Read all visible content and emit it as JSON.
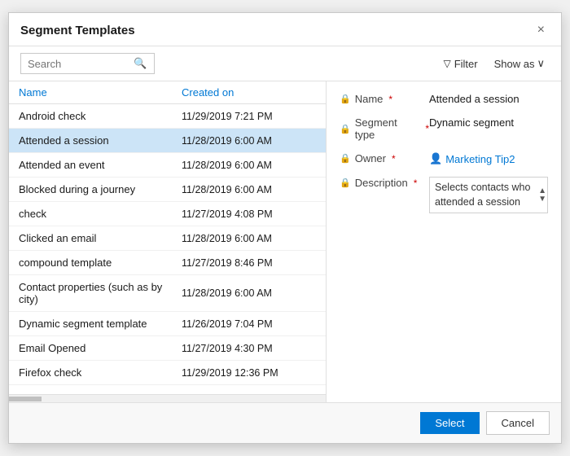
{
  "dialog": {
    "title": "Segment Templates",
    "close_label": "×"
  },
  "toolbar": {
    "search_placeholder": "Search",
    "search_icon": "🔍",
    "filter_label": "Filter",
    "filter_icon": "▽",
    "show_as_label": "Show as",
    "show_as_icon": "∨"
  },
  "list": {
    "col_name": "Name",
    "col_created": "Created on",
    "rows": [
      {
        "name": "Android check",
        "date": "11/29/2019 7:21 PM",
        "selected": false
      },
      {
        "name": "Attended a session",
        "date": "11/28/2019 6:00 AM",
        "selected": true
      },
      {
        "name": "Attended an event",
        "date": "11/28/2019 6:00 AM",
        "selected": false
      },
      {
        "name": "Blocked during a journey",
        "date": "11/28/2019 6:00 AM",
        "selected": false
      },
      {
        "name": "check",
        "date": "11/27/2019 4:08 PM",
        "selected": false
      },
      {
        "name": "Clicked an email",
        "date": "11/28/2019 6:00 AM",
        "selected": false
      },
      {
        "name": "compound template",
        "date": "11/27/2019 8:46 PM",
        "selected": false
      },
      {
        "name": "Contact properties (such as by city)",
        "date": "11/28/2019 6:00 AM",
        "selected": false
      },
      {
        "name": "Dynamic segment template",
        "date": "11/26/2019 7:04 PM",
        "selected": false
      },
      {
        "name": "Email Opened",
        "date": "11/27/2019 4:30 PM",
        "selected": false
      },
      {
        "name": "Firefox check",
        "date": "11/29/2019 12:36 PM",
        "selected": false
      }
    ]
  },
  "detail": {
    "name_label": "Name",
    "name_value": "Attended a session",
    "segment_type_label": "Segment type",
    "segment_type_value": "Dynamic segment",
    "owner_label": "Owner",
    "owner_value": "Marketing Tip2",
    "description_label": "Description",
    "description_value": "Selects contacts who attended a session"
  },
  "footer": {
    "select_label": "Select",
    "cancel_label": "Cancel"
  }
}
